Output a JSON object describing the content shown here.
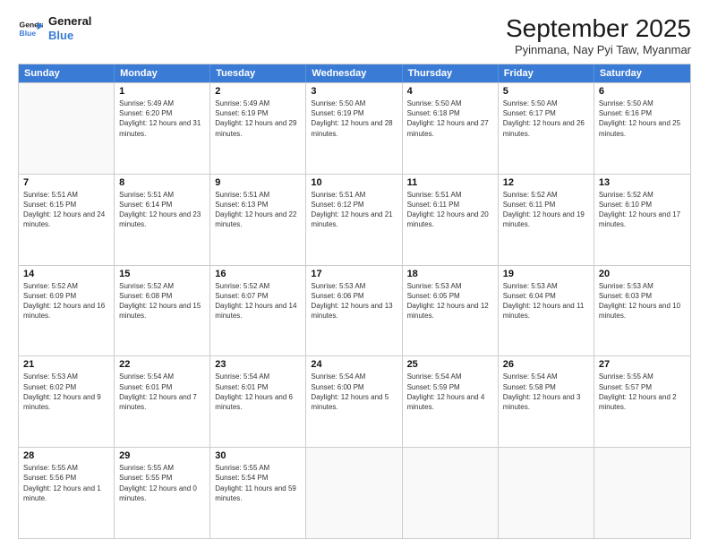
{
  "header": {
    "logo_line1": "General",
    "logo_line2": "Blue",
    "month": "September 2025",
    "location": "Pyinmana, Nay Pyi Taw, Myanmar"
  },
  "weekdays": [
    "Sunday",
    "Monday",
    "Tuesday",
    "Wednesday",
    "Thursday",
    "Friday",
    "Saturday"
  ],
  "weeks": [
    [
      {
        "day": "",
        "empty": true
      },
      {
        "day": "1",
        "sunrise": "5:49 AM",
        "sunset": "6:20 PM",
        "daylight": "12 hours and 31 minutes."
      },
      {
        "day": "2",
        "sunrise": "5:49 AM",
        "sunset": "6:19 PM",
        "daylight": "12 hours and 29 minutes."
      },
      {
        "day": "3",
        "sunrise": "5:50 AM",
        "sunset": "6:19 PM",
        "daylight": "12 hours and 28 minutes."
      },
      {
        "day": "4",
        "sunrise": "5:50 AM",
        "sunset": "6:18 PM",
        "daylight": "12 hours and 27 minutes."
      },
      {
        "day": "5",
        "sunrise": "5:50 AM",
        "sunset": "6:17 PM",
        "daylight": "12 hours and 26 minutes."
      },
      {
        "day": "6",
        "sunrise": "5:50 AM",
        "sunset": "6:16 PM",
        "daylight": "12 hours and 25 minutes."
      }
    ],
    [
      {
        "day": "7",
        "sunrise": "5:51 AM",
        "sunset": "6:15 PM",
        "daylight": "12 hours and 24 minutes."
      },
      {
        "day": "8",
        "sunrise": "5:51 AM",
        "sunset": "6:14 PM",
        "daylight": "12 hours and 23 minutes."
      },
      {
        "day": "9",
        "sunrise": "5:51 AM",
        "sunset": "6:13 PM",
        "daylight": "12 hours and 22 minutes."
      },
      {
        "day": "10",
        "sunrise": "5:51 AM",
        "sunset": "6:12 PM",
        "daylight": "12 hours and 21 minutes."
      },
      {
        "day": "11",
        "sunrise": "5:51 AM",
        "sunset": "6:11 PM",
        "daylight": "12 hours and 20 minutes."
      },
      {
        "day": "12",
        "sunrise": "5:52 AM",
        "sunset": "6:11 PM",
        "daylight": "12 hours and 19 minutes."
      },
      {
        "day": "13",
        "sunrise": "5:52 AM",
        "sunset": "6:10 PM",
        "daylight": "12 hours and 17 minutes."
      }
    ],
    [
      {
        "day": "14",
        "sunrise": "5:52 AM",
        "sunset": "6:09 PM",
        "daylight": "12 hours and 16 minutes."
      },
      {
        "day": "15",
        "sunrise": "5:52 AM",
        "sunset": "6:08 PM",
        "daylight": "12 hours and 15 minutes."
      },
      {
        "day": "16",
        "sunrise": "5:52 AM",
        "sunset": "6:07 PM",
        "daylight": "12 hours and 14 minutes."
      },
      {
        "day": "17",
        "sunrise": "5:53 AM",
        "sunset": "6:06 PM",
        "daylight": "12 hours and 13 minutes."
      },
      {
        "day": "18",
        "sunrise": "5:53 AM",
        "sunset": "6:05 PM",
        "daylight": "12 hours and 12 minutes."
      },
      {
        "day": "19",
        "sunrise": "5:53 AM",
        "sunset": "6:04 PM",
        "daylight": "12 hours and 11 minutes."
      },
      {
        "day": "20",
        "sunrise": "5:53 AM",
        "sunset": "6:03 PM",
        "daylight": "12 hours and 10 minutes."
      }
    ],
    [
      {
        "day": "21",
        "sunrise": "5:53 AM",
        "sunset": "6:02 PM",
        "daylight": "12 hours and 9 minutes."
      },
      {
        "day": "22",
        "sunrise": "5:54 AM",
        "sunset": "6:01 PM",
        "daylight": "12 hours and 7 minutes."
      },
      {
        "day": "23",
        "sunrise": "5:54 AM",
        "sunset": "6:01 PM",
        "daylight": "12 hours and 6 minutes."
      },
      {
        "day": "24",
        "sunrise": "5:54 AM",
        "sunset": "6:00 PM",
        "daylight": "12 hours and 5 minutes."
      },
      {
        "day": "25",
        "sunrise": "5:54 AM",
        "sunset": "5:59 PM",
        "daylight": "12 hours and 4 minutes."
      },
      {
        "day": "26",
        "sunrise": "5:54 AM",
        "sunset": "5:58 PM",
        "daylight": "12 hours and 3 minutes."
      },
      {
        "day": "27",
        "sunrise": "5:55 AM",
        "sunset": "5:57 PM",
        "daylight": "12 hours and 2 minutes."
      }
    ],
    [
      {
        "day": "28",
        "sunrise": "5:55 AM",
        "sunset": "5:56 PM",
        "daylight": "12 hours and 1 minute."
      },
      {
        "day": "29",
        "sunrise": "5:55 AM",
        "sunset": "5:55 PM",
        "daylight": "12 hours and 0 minutes."
      },
      {
        "day": "30",
        "sunrise": "5:55 AM",
        "sunset": "5:54 PM",
        "daylight": "11 hours and 59 minutes."
      },
      {
        "day": "",
        "empty": true
      },
      {
        "day": "",
        "empty": true
      },
      {
        "day": "",
        "empty": true
      },
      {
        "day": "",
        "empty": true
      }
    ]
  ]
}
